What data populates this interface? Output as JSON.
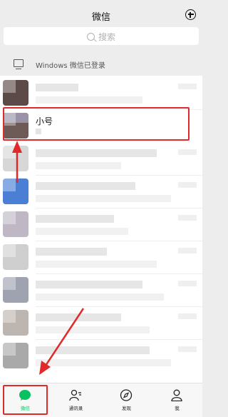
{
  "header": {
    "title": "微信"
  },
  "search": {
    "placeholder": "搜索"
  },
  "pc_login": {
    "text": "Windows 微信已登录"
  },
  "chat": {
    "highlighted_name": "小号"
  },
  "tabs": [
    {
      "label": "微信",
      "icon": "chat-bubble-icon",
      "active": true
    },
    {
      "label": "通讯录",
      "icon": "contacts-icon",
      "active": false
    },
    {
      "label": "发现",
      "icon": "compass-icon",
      "active": false
    },
    {
      "label": "我",
      "icon": "person-icon",
      "active": false
    }
  ],
  "colors": {
    "accent": "#07c160",
    "annotation": "#e02a2a",
    "background": "#ededed"
  }
}
